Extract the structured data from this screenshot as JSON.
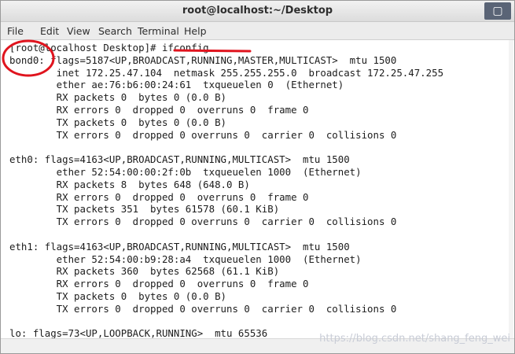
{
  "window": {
    "title": "root@localhost:~/Desktop"
  },
  "menu": [
    "File",
    "Edit",
    "View",
    "Search",
    "Terminal",
    "Help"
  ],
  "terminal_lines": [
    "[root@localhost Desktop]# ifconfig",
    "bond0: flags=5187<UP,BROADCAST,RUNNING,MASTER,MULTICAST>  mtu 1500",
    "        inet 172.25.47.104  netmask 255.255.255.0  broadcast 172.25.47.255",
    "        ether ae:76:b6:00:24:61  txqueuelen 0  (Ethernet)",
    "        RX packets 0  bytes 0 (0.0 B)",
    "        RX errors 0  dropped 0  overruns 0  frame 0",
    "        TX packets 0  bytes 0 (0.0 B)",
    "        TX errors 0  dropped 0 overruns 0  carrier 0  collisions 0",
    "",
    "eth0: flags=4163<UP,BROADCAST,RUNNING,MULTICAST>  mtu 1500",
    "        ether 52:54:00:00:2f:0b  txqueuelen 1000  (Ethernet)",
    "        RX packets 8  bytes 648 (648.0 B)",
    "        RX errors 0  dropped 0  overruns 0  frame 0",
    "        TX packets 351  bytes 61578 (60.1 KiB)",
    "        TX errors 0  dropped 0 overruns 0  carrier 0  collisions 0",
    "",
    "eth1: flags=4163<UP,BROADCAST,RUNNING,MULTICAST>  mtu 1500",
    "        ether 52:54:00:b9:28:a4  txqueuelen 1000  (Ethernet)",
    "        RX packets 360  bytes 62568 (61.1 KiB)",
    "        RX errors 0  dropped 0  overruns 0  frame 0",
    "        TX packets 0  bytes 0 (0.0 B)",
    "        TX errors 0  dropped 0 overruns 0  carrier 0  collisions 0",
    "",
    "lo: flags=73<UP,LOOPBACK,RUNNING>  mtu 65536"
  ],
  "watermark": "https://blog.csdn.net/shang_feng_wei",
  "colors": {
    "annotation_red": "#e0141e",
    "terminal_bg": "#ffffff",
    "terminal_fg": "#1c1c1c"
  }
}
